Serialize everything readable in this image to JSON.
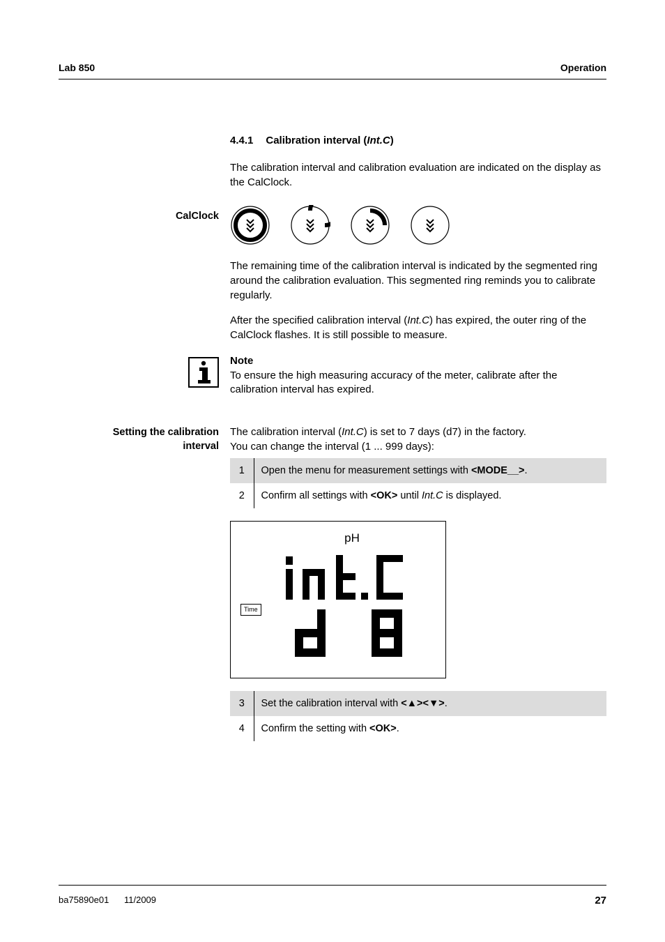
{
  "header": {
    "left": "Lab 850",
    "right": "Operation"
  },
  "section": {
    "num": "4.4.1",
    "title_prefix": "Calibration interval (",
    "title_ital": "Int.C",
    "title_suffix": ")"
  },
  "intro": "The calibration interval and calibration evaluation are indicated on the display as the CalClock.",
  "leftlabels": {
    "calclock": "CalClock",
    "setting1": "Setting the calibration",
    "setting2": "interval"
  },
  "calclock_para1": "The remaining time of the calibration interval is indicated by the segmented ring around the calibration evaluation. This segmented ring reminds you to calibrate regularly.",
  "calclock_para2_a": "After the specified calibration interval (",
  "calclock_para2_ital": "Int.C",
  "calclock_para2_b": ") has expired, the outer ring of the CalClock flashes. It is still possible to measure.",
  "note": {
    "heading": "Note",
    "body": "To ensure the high measuring accuracy of the meter, calibrate after the calibration interval has expired."
  },
  "setting_para_a": "The calibration interval (",
  "setting_para_ital": "Int.C",
  "setting_para_b": ") is set to 7 days (d7) in the factory.",
  "setting_para_c": "You can change the interval (1 ... 999 days):",
  "steps": {
    "s1_a": "Open the menu for measurement settings with ",
    "s1_b": "<MODE__>",
    "s1_c": ".",
    "s2_a": "Confirm all settings with ",
    "s2_b": "<OK>",
    "s2_c": " until ",
    "s2_ital": "Int.C",
    "s2_d": " is displayed.",
    "s3_a": "Set the calibration interval with ",
    "s3_b": "<▲><▼>",
    "s3_c": ".",
    "s4_a": "Confirm the setting with ",
    "s4_b": "<OK>",
    "s4_c": "."
  },
  "nums": {
    "n1": "1",
    "n2": "2",
    "n3": "3",
    "n4": "4"
  },
  "lcd": {
    "ph": "pH",
    "time": "Time"
  },
  "footer": {
    "doc": "ba75890e01",
    "date": "11/2009",
    "page": "27"
  }
}
